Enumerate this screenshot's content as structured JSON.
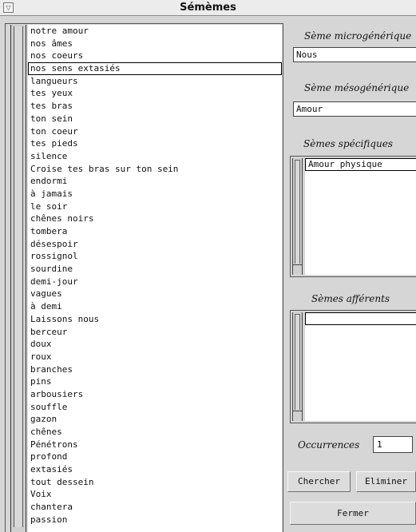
{
  "window": {
    "title": "Sémèmes",
    "menu_glyph": "▽"
  },
  "sememes": {
    "selected_index": 3,
    "items": [
      "notre amour",
      "nos âmes",
      "nos coeurs",
      "nos sens extasiés",
      "langueurs",
      "tes yeux",
      "tes bras",
      "ton sein",
      "ton coeur",
      "tes pieds",
      "silence",
      "Croise tes bras sur ton sein",
      "endormi",
      "à jamais",
      "le soir",
      "chênes noirs",
      "tombera",
      "désespoir",
      "rossignol",
      "sourdine",
      "demi-jour",
      "vagues",
      "à demi",
      "Laissons nous",
      "berceur",
      "doux",
      "roux",
      "branches",
      "pins",
      "arbousiers",
      "souffle",
      "gazon",
      "chênes",
      "Pénétrons",
      "profond",
      "extasiés",
      "tout dessein",
      "Voix",
      "chantera",
      "passion"
    ]
  },
  "right": {
    "microgenerique_label": "Sème microgénérique",
    "microgenerique_value": "Nous",
    "mesogenerique_label": "Sème mésogénérique",
    "mesogenerique_value": "Amour",
    "specifiques_label": "Sèmes spécifiques",
    "specifiques_items": [
      "Amour physique"
    ],
    "afferents_label": "Sèmes afférents",
    "afferents_items": [
      ""
    ],
    "occurrences_label": "Occurrences",
    "occurrences_value": "1",
    "chercher_label": "Chercher",
    "eliminer_label": "Eliminer",
    "fermer_label": "Fermer"
  }
}
